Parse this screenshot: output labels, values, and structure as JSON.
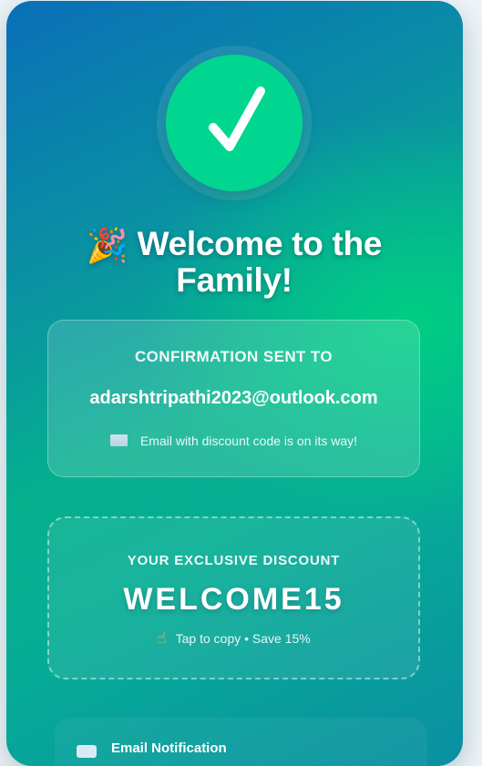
{
  "success": {
    "check_icon": "checkmark-icon",
    "title_emoji": "🎉",
    "title": "Welcome to the Family!"
  },
  "confirmation": {
    "label": "CONFIRMATION SENT TO",
    "email": "adarshtripathi2023@outlook.com",
    "note_icon": "envelope-icon",
    "note": "Email with discount code is on its way!"
  },
  "discount": {
    "label": "YOUR EXCLUSIVE DISCOUNT",
    "code": "WELCOME15",
    "hint_icon": "pointing-hand-icon",
    "hint": "Tap to copy • Save 15%"
  },
  "notification": {
    "icon": "email-icon",
    "title": "Email Notification"
  },
  "colors": {
    "check_circle": "#00d68f",
    "gradient_start": "#0a6fb8",
    "gradient_mid": "#05b08f",
    "text": "#ffffff"
  }
}
